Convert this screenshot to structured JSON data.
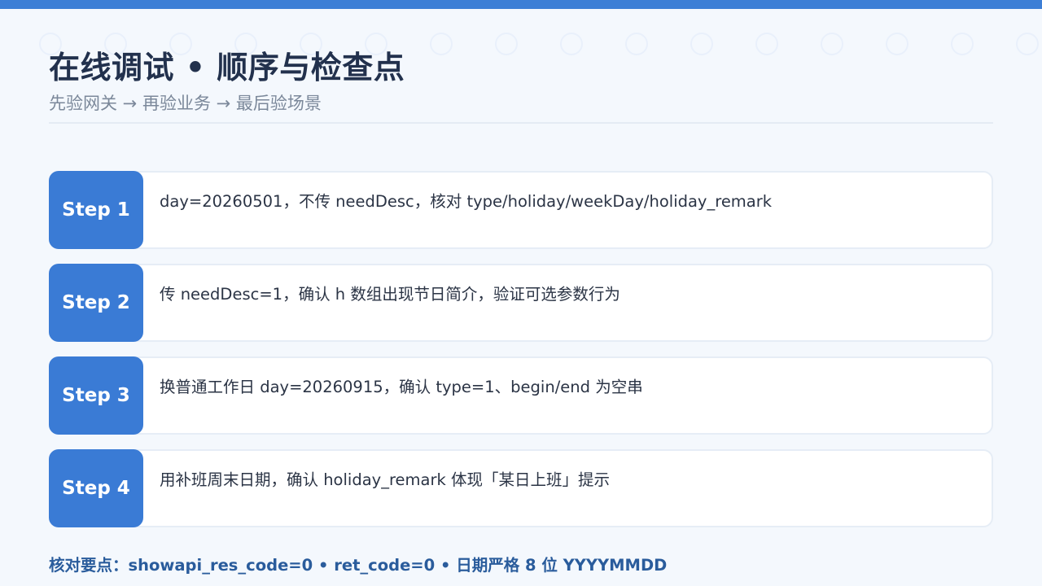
{
  "header": {
    "title": "在线调试 • 顺序与检查点",
    "subtitle": "先验网关 → 再验业务 → 最后验场景"
  },
  "steps": [
    {
      "label": "Step 1",
      "text": "day=20260501，不传 needDesc，核对 type/holiday/weekDay/holiday_remark"
    },
    {
      "label": "Step 2",
      "text": "传 needDesc=1，确认 h 数组出现节日简介，验证可选参数行为"
    },
    {
      "label": "Step 3",
      "text": "换普通工作日 day=20260915，确认 type=1、begin/end 为空串"
    },
    {
      "label": "Step 4",
      "text": "用补班周末日期，确认 holiday_remark 体现「某日上班」提示"
    }
  ],
  "footer": {
    "note": "核对要点：showapi_res_code=0 • ret_code=0 • 日期严格 8 位 YYYYMMDD"
  },
  "colors": {
    "accent": "#3a7bd5",
    "top_bar": "#3d7fd6",
    "background": "#f4f8fd",
    "title": "#22314d",
    "subtitle": "#7b889a",
    "footer_text": "#2a5c9c"
  }
}
